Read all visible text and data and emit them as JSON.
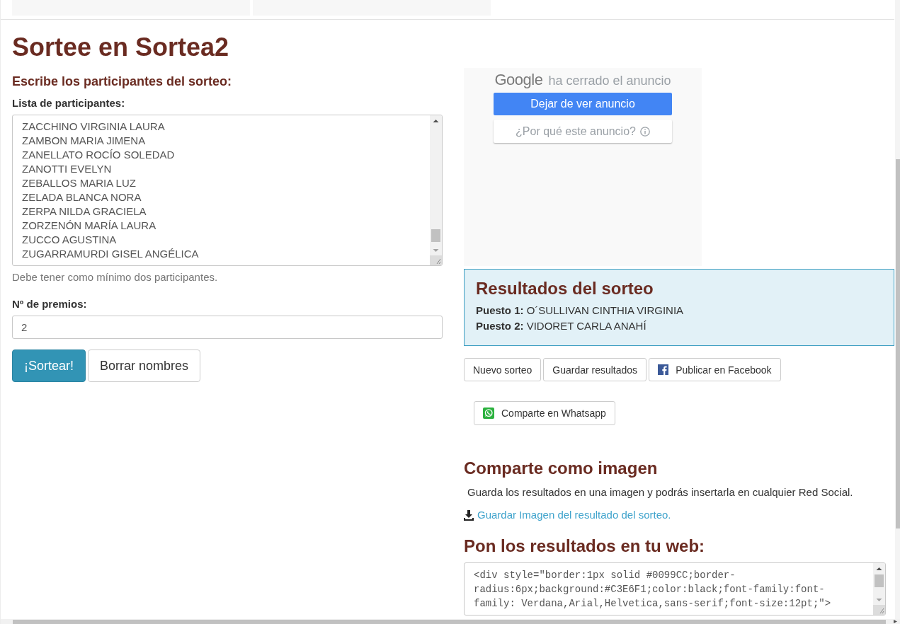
{
  "page": {
    "title": "Sortee en Sortea2"
  },
  "form": {
    "heading": "Escribe los participantes del sorteo:",
    "participants_label": "Lista de participantes:",
    "participants": [
      "ZACCHINO VIRGINIA LAURA",
      "ZAMBON MARIA JIMENA",
      "ZANELLATO ROCÍO SOLEDAD",
      "ZANOTTI EVELYN",
      "ZEBALLOS MARIA LUZ",
      "ZELADA BLANCA NORA",
      "ZERPA NILDA GRACIELA",
      "ZORZENÓN MARÍA LAURA",
      "ZUCCO AGUSTINA",
      "ZUGARRAMURDI GISEL ANGÉLICA"
    ],
    "participants_help": "Debe tener como mínimo dos participantes.",
    "prizes_label": "Nº de premios:",
    "prizes_value": "2",
    "buttons": [
      {
        "label": "¡Sortear!",
        "kind": "primary"
      },
      {
        "label": "Borrar nombres",
        "kind": "default"
      }
    ]
  },
  "ad_notice": {
    "brand": "Google",
    "message": "ha cerrado el anuncio",
    "buttons": [
      {
        "label": "Dejar de ver anuncio",
        "kind": "primary"
      },
      {
        "label": "¿Por qué este anuncio?",
        "kind": "explain"
      }
    ]
  },
  "results": {
    "title": "Resultados del sorteo",
    "winners": [
      "**Puesto 1:** O´SULLIVAN CINTHIA VIRGINIA",
      "**Puesto 2:** VIDORET CARLA ANAHÍ"
    ]
  },
  "share_buttons": [
    {
      "label": "Nuevo sorteo",
      "kind": "plain"
    },
    {
      "label": "Guardar resultados",
      "kind": "plain"
    },
    {
      "label": "Publicar en Facebook",
      "kind": "facebook"
    },
    {
      "label": "Comparte en Whatsapp",
      "kind": "whatsapp"
    }
  ],
  "image_share": {
    "title": "Comparte como imagen",
    "text": "Guarda los resultados en una imagen y podrás insertarla en cualquier Red Social.",
    "link": "Guardar Imagen del resultado del sorteo."
  },
  "embed": {
    "title": "Pon los resultados en tu web:",
    "code": "<div style=\"border:1px solid #0099CC;border-radius:6px;background:#C3E6F1;color:black;font-family:font-family: Verdana,Arial,Helvetica,sans-serif;font-size:12pt;\">"
  }
}
